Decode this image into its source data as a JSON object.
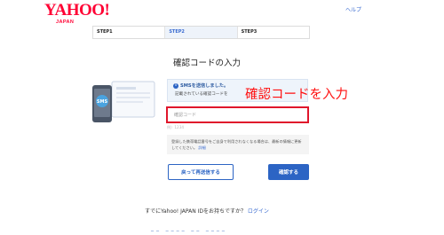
{
  "brand": {
    "logo": "YAHOO!",
    "logo_sub": "JAPAN",
    "color": "#ff0033"
  },
  "header": {
    "help_link": "ヘルプ"
  },
  "steps": [
    {
      "label": "STEP1",
      "active": false
    },
    {
      "label": "STEP2",
      "active": true
    },
    {
      "label": "STEP3",
      "active": false
    }
  ],
  "page_title": "確認コードの入力",
  "illustration": {
    "phone_badge": "SMS"
  },
  "sms_notice": {
    "icon": "info-icon",
    "title": "SMSを送信しました。",
    "description": "記載されている確認コードを"
  },
  "annotation": "確認コードを入力",
  "code_field": {
    "placeholder": "確認コード",
    "value": ""
  },
  "hint": "例）1234",
  "note": {
    "text": "登録した携帯電話番号をご自身で利用されなくなる場合は、最新の情報に更新してください。",
    "link": "詳細"
  },
  "buttons": {
    "resend": "戻って再送信する",
    "confirm": "確認する"
  },
  "login_prompt": {
    "text": "すでにYahoo! JAPAN IDをお持ちですか？",
    "link": "ログイン"
  },
  "colors": {
    "accent": "#2c64c4",
    "annotation": "#ff1010"
  }
}
